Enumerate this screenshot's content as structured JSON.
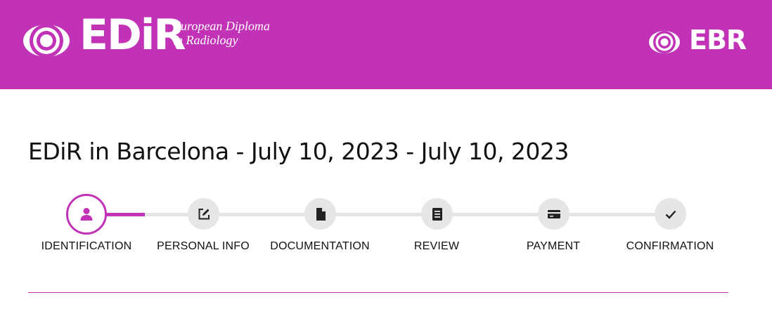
{
  "header": {
    "brand": "EDiR",
    "tagline_line1": "European Diploma",
    "tagline_line2": "in Radiology",
    "partner_brand": "EBR",
    "background_color": "#c132b6",
    "edir_logo_icon": "eye-target-icon",
    "ebr_logo_icon": "eye-target-icon"
  },
  "page": {
    "title": "EDiR in Barcelona - July 10, 2023 - July 10, 2023"
  },
  "stepper": {
    "accent_color": "#c132b6",
    "current_step": 1,
    "steps": [
      {
        "label": "IDENTIFICATION",
        "icon": "person-icon",
        "state": "active"
      },
      {
        "label": "PERSONAL INFO",
        "icon": "edit-icon",
        "state": "pending"
      },
      {
        "label": "DOCUMENTATION",
        "icon": "document-icon",
        "state": "pending"
      },
      {
        "label": "REVIEW",
        "icon": "list-document-icon",
        "state": "pending"
      },
      {
        "label": "PAYMENT",
        "icon": "credit-card-icon",
        "state": "pending"
      },
      {
        "label": "CONFIRMATION",
        "icon": "check-icon",
        "state": "pending"
      }
    ]
  }
}
